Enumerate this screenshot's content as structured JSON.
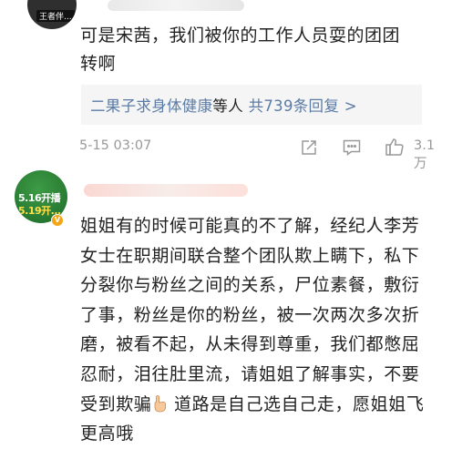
{
  "comment1": {
    "avatar_tag": "王者伴...",
    "text": "可是宋茜，我们被你的工作人员耍的团团转啊",
    "reply": {
      "users": "二果子求身体健康",
      "suffix": "等人",
      "count_text": "共739条回复 >"
    },
    "time": "5-15 03:07",
    "likes": "3.1万"
  },
  "comment2": {
    "avatar_line1": "5.16开播",
    "avatar_line2": "5.19开...",
    "text_part1": "姐姐有的时候可能真的不了解，经纪人李芳女士在职期间联合整个团队欺上瞒下，私下分裂你与粉丝之间的关系，尸位素餐，敷衍了事，粉丝是你的粉丝，被一次两次多次折磨，被看不起，从未得到尊重，我们都憋屈忍耐，泪往肚里流，请姐姐了解事实，不要受到欺骗",
    "text_part2": " 道路是自己选自己走，愿姐姐飞更高哦"
  },
  "icons": [
    "share-icon",
    "comment-icon",
    "like-icon",
    "hand-emoji-icon",
    "verified-badge-icon"
  ],
  "colors": {
    "link": "#5a7ba6",
    "meta": "#999999",
    "reply_bg": "#f5f5f5"
  }
}
